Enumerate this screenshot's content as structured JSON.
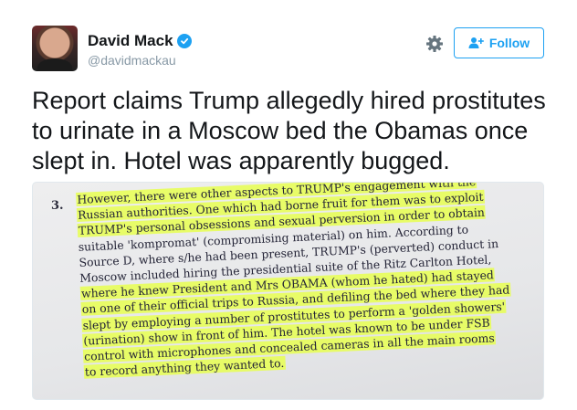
{
  "user": {
    "display_name": "David Mack",
    "handle": "@davidmackau"
  },
  "actions": {
    "follow_label": "Follow"
  },
  "tweet": {
    "text": "Report claims Trump allegedly hired prostitutes to urinate in a Moscow bed the Obamas once slept in. Hotel was apparently bugged."
  },
  "document": {
    "number": "3.",
    "lines": [
      "However, there were other aspects to TRUMP's engagement with the",
      "Russian authorities. One which had borne fruit for them was to exploit",
      "TRUMP's personal obsessions and sexual perversion in order to obtain",
      "suitable 'kompromat' (compromising material) on him. According to",
      "Source D, where s/he had been present, TRUMP's (perverted) conduct in",
      "Moscow included hiring the presidential suite of the Ritz Carlton Hotel,",
      "where he knew President and Mrs OBAMA (whom he hated) had stayed",
      "on one of their official trips to Russia, and defiling the bed where they had",
      "slept by employing a number of prostitutes to perform a 'golden showers'",
      "(urination) show in front of him. The hotel was known to be under FSB",
      "control with microphones and concealed cameras in all the main rooms",
      "to record anything they wanted to."
    ]
  },
  "icons": {
    "verified": "verified-badge-icon",
    "settings": "gear-icon",
    "follow": "person-plus-icon"
  },
  "colors": {
    "accent": "#1da1f2",
    "highlight": "#e8ff50",
    "text": "#14171a",
    "muted": "#8899a6"
  }
}
